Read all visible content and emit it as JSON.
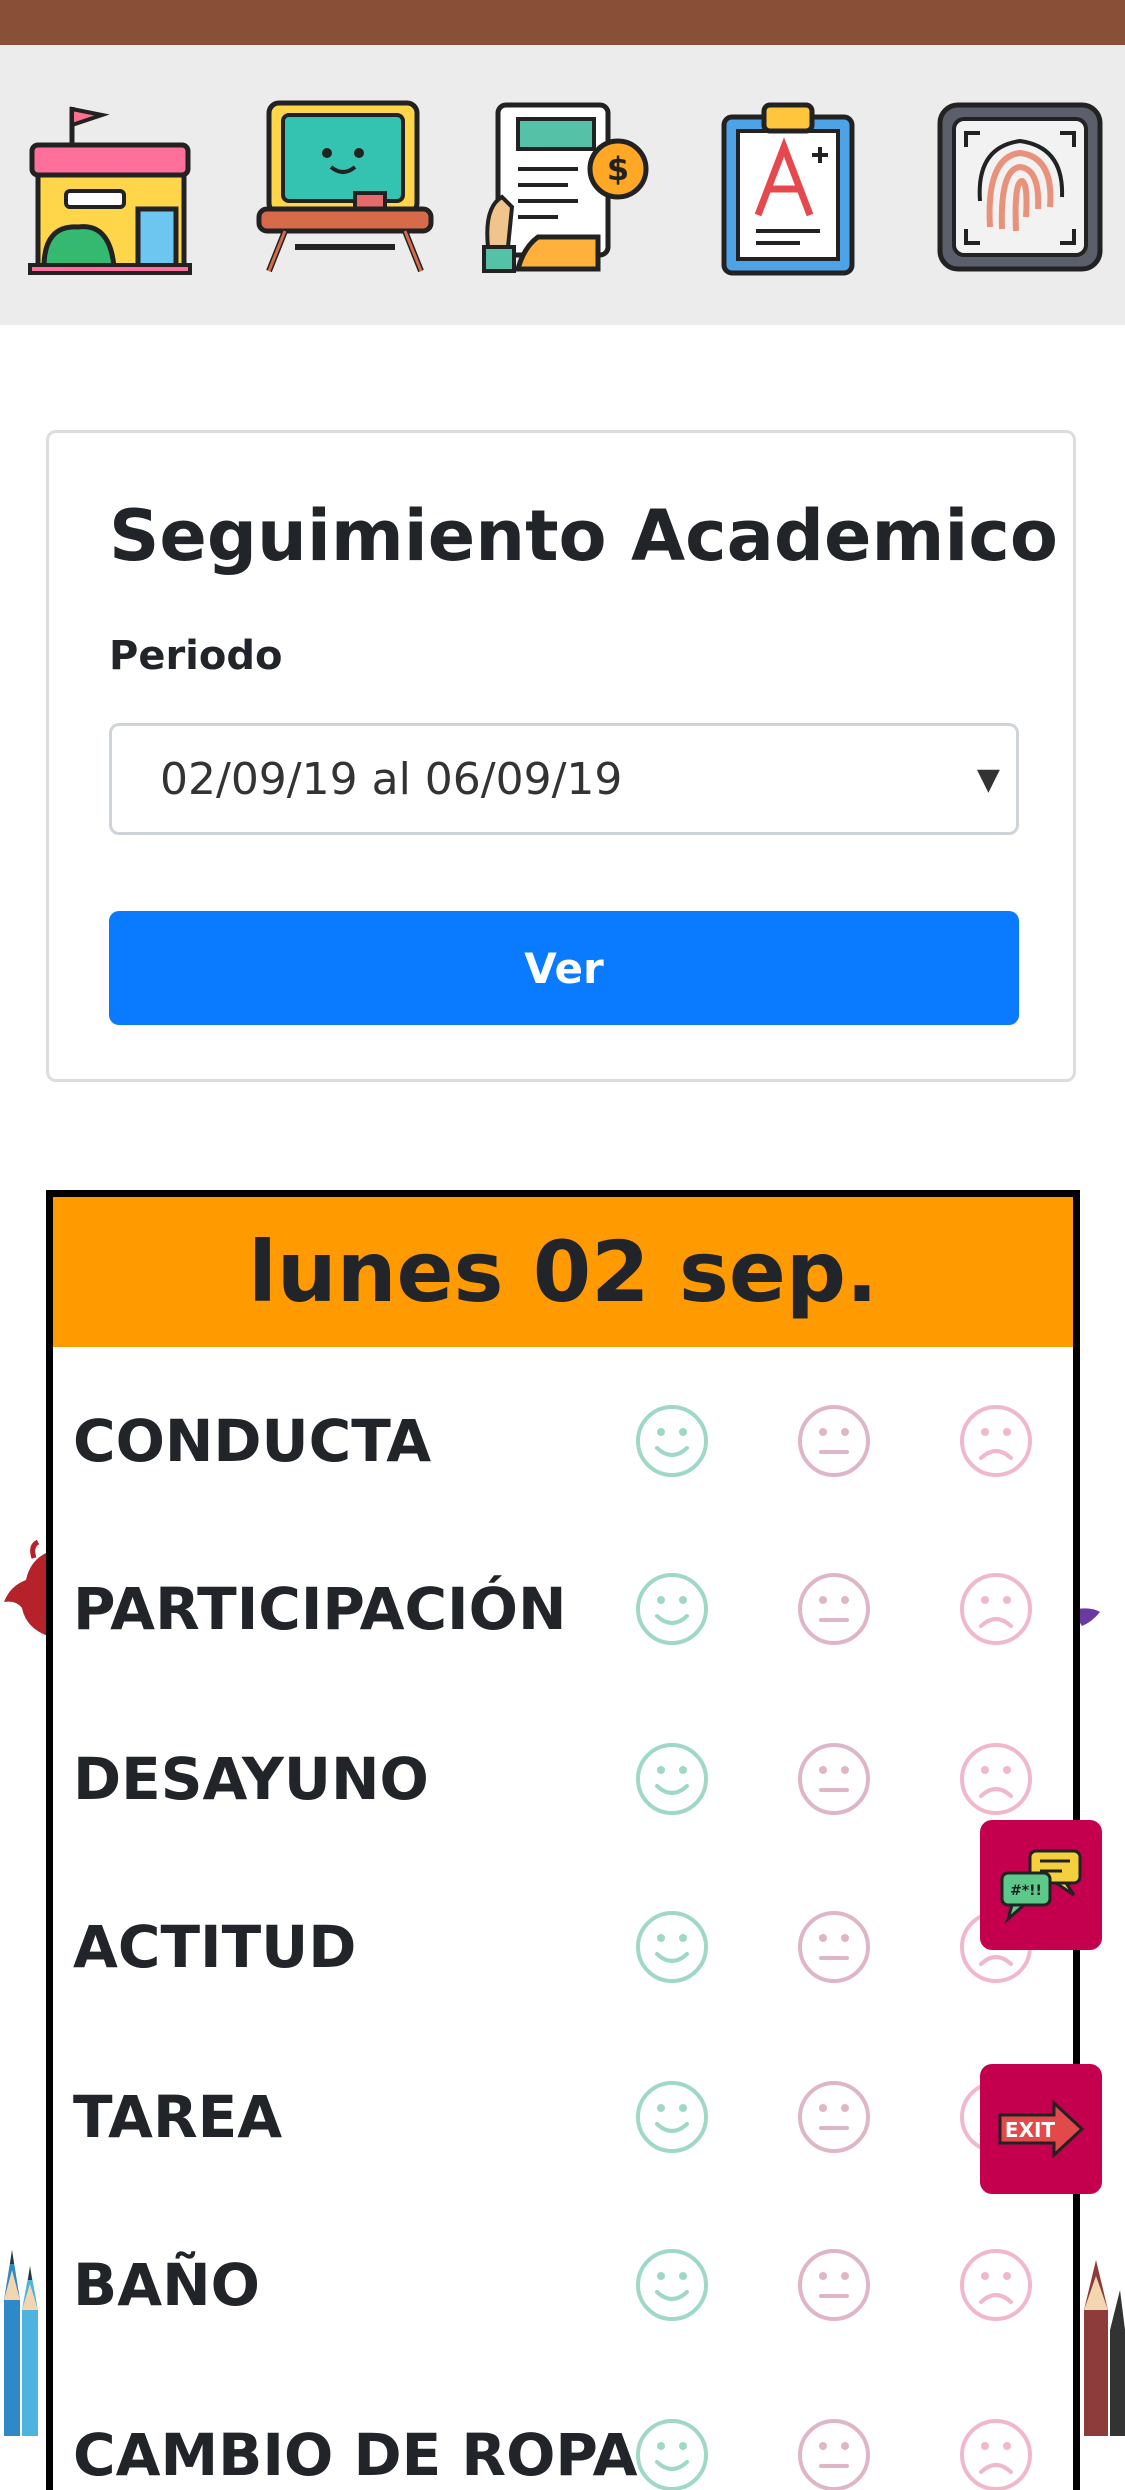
{
  "nav_icons": [
    "school-building-icon",
    "classroom-desk-icon",
    "payment-invoice-icon",
    "grade-report-icon",
    "fingerprint-icon"
  ],
  "card": {
    "title": "Seguimiento Academico",
    "period_label": "Periodo",
    "period_value": "02/09/19 al 06/09/19",
    "button_label": "Ver"
  },
  "day": {
    "header": "lunes 02 sep.",
    "header_color": "#ff9a00",
    "rows": [
      {
        "label": "CONDUCTA"
      },
      {
        "label": "PARTICIPACIÓN"
      },
      {
        "label": "DESAYUNO"
      },
      {
        "label": "ACTITUD"
      },
      {
        "label": "TAREA"
      },
      {
        "label": "BAÑO"
      },
      {
        "label": "CAMBIO DE ROPA"
      }
    ],
    "face_colors": {
      "happy": "#9fd8c6",
      "neutral": "#dfb6c7",
      "sad": "#f0b8c8"
    }
  },
  "floating_buttons": {
    "chat": "chat-bubbles-icon",
    "exit": "exit-sign-icon",
    "color": "#c4004e"
  }
}
